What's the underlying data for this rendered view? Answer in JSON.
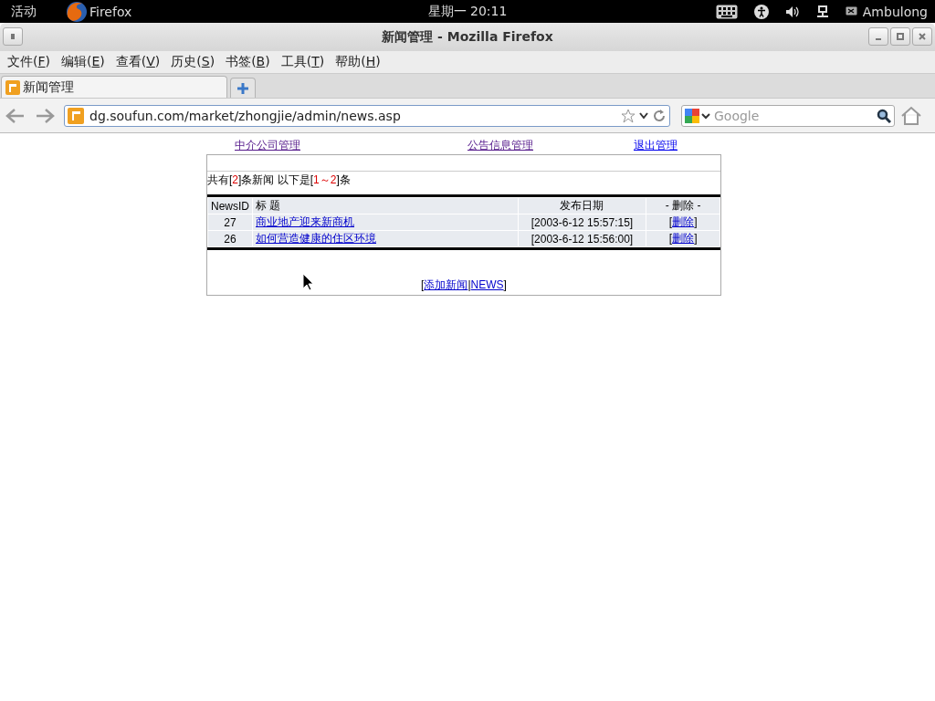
{
  "top_bar": {
    "activities": "活动",
    "app": "Firefox",
    "clock": "星期一 20:11",
    "user": "Ambulong"
  },
  "window": {
    "title": "新闻管理 - Mozilla Firefox"
  },
  "menu": [
    "文件(F)",
    "编辑(E)",
    "查看(V)",
    "历史(S)",
    "书签(B)",
    "工具(T)",
    "帮助(H)"
  ],
  "tabs": [
    {
      "label": "新闻管理",
      "selected": true
    }
  ],
  "address_bar": {
    "value": "dg.soufun.com/market/zhongjie/admin/news.asp"
  },
  "search": {
    "placeholder": "Google"
  },
  "page": {
    "nav_links": [
      {
        "text": "中介公司管理",
        "visited": true
      },
      {
        "text": "公告信息管理",
        "visited": true
      },
      {
        "text": "退出管理",
        "visited": false
      }
    ],
    "summary": [
      {
        "kind": "text",
        "text": "共有["
      },
      {
        "kind": "count",
        "text": "2"
      },
      {
        "kind": "text",
        "text": "]条新闻 以下是["
      },
      {
        "kind": "count",
        "text": "1～2"
      },
      {
        "kind": "text",
        "text": "]条"
      }
    ],
    "table": {
      "columns": [
        "NewsID",
        "标 题",
        "发布日期",
        "- 删除 -"
      ],
      "rows": [
        {
          "id": "27",
          "title": "商业地产迎来新商机",
          "date": "[2003-6-12 15:57:15]",
          "delete": [
            {
              "kind": "text",
              "text": "["
            },
            {
              "kind": "link",
              "text": "删除"
            },
            {
              "kind": "text",
              "text": "]"
            }
          ]
        },
        {
          "id": "26",
          "title": "如何营造健康的住区环境",
          "date": "[2003-6-12 15:56:00]",
          "delete": [
            {
              "kind": "text",
              "text": "["
            },
            {
              "kind": "link",
              "text": "删除"
            },
            {
              "kind": "text",
              "text": "]"
            }
          ]
        }
      ]
    },
    "footer": [
      {
        "kind": "text",
        "text": "["
      },
      {
        "kind": "link",
        "text": "添加新闻"
      },
      {
        "kind": "text",
        "text": "|"
      },
      {
        "kind": "link",
        "text": "NEWS"
      },
      {
        "kind": "text",
        "text": "]"
      }
    ]
  }
}
